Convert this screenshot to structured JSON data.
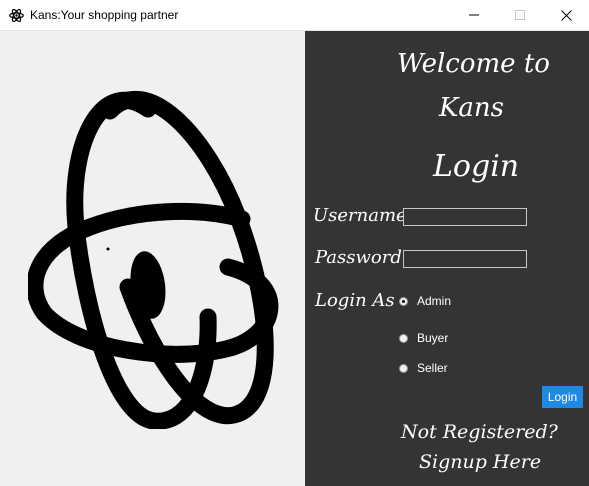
{
  "window": {
    "title": "Kans:Your shopping partner",
    "app_icon": "atom-icon",
    "controls": {
      "minimize_icon": "minimize-icon",
      "maximize_icon": "maximize-icon",
      "close_icon": "close-icon"
    }
  },
  "left_panel": {
    "logo_icon": "atom-logo-icon"
  },
  "form": {
    "welcome": "Welcome to",
    "app_name": "Kans",
    "heading": "Login",
    "username_label": "Username",
    "username_value": "",
    "password_label": "Password",
    "password_value": "",
    "login_as_label": "Login As",
    "roles": [
      {
        "label": "Admin",
        "selected": true
      },
      {
        "label": "Buyer",
        "selected": false
      },
      {
        "label": "Seller",
        "selected": false
      }
    ],
    "login_button": "Login",
    "not_registered": "Not Registered?",
    "signup": "Signup Here"
  },
  "colors": {
    "left_bg": "#f0f0f0",
    "right_bg": "#343434",
    "accent": "#1e88e5",
    "text": "#ffffff"
  }
}
